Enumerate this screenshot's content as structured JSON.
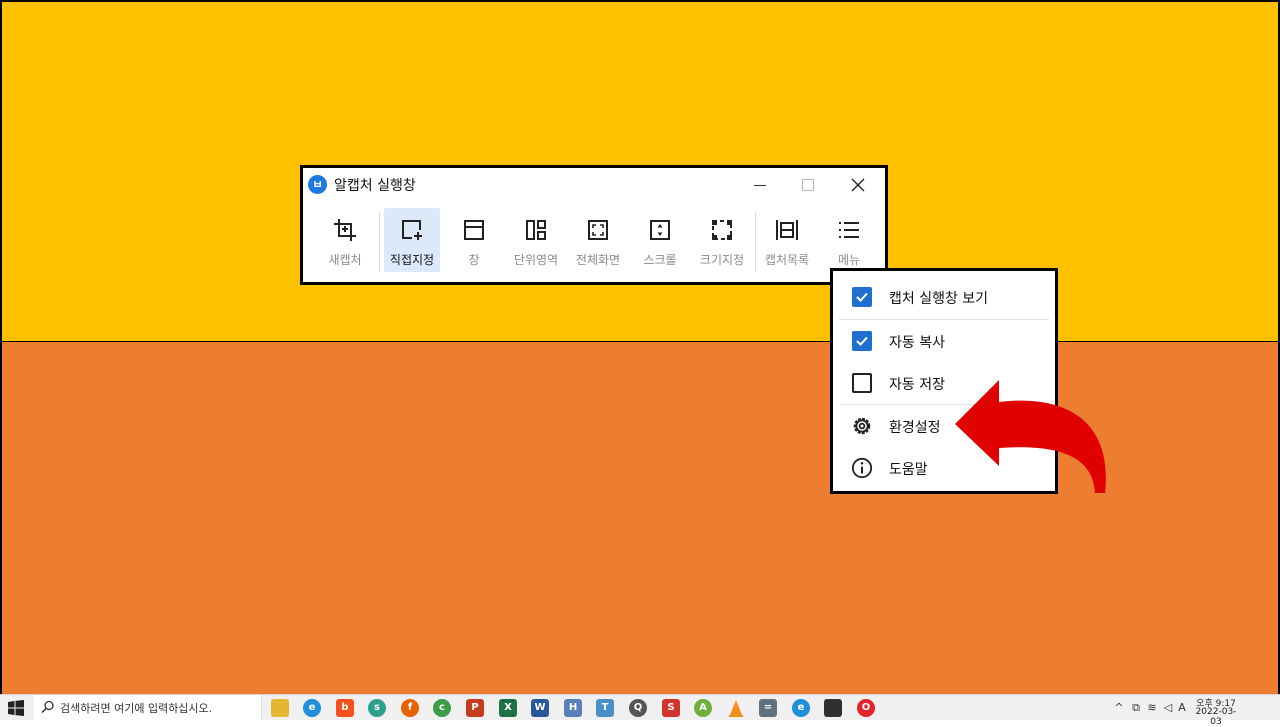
{
  "colors": {
    "background_top": "#FFC000",
    "background_bottom": "#ED7D31",
    "accent": "#1F6FD0",
    "active_tool_bg": "#DBE9F8",
    "arrow": "#E00000"
  },
  "window": {
    "title": "알캡처 실행창",
    "logo_icon": "alcapture-logo-icon",
    "controls": [
      "minimize",
      "maximize",
      "close"
    ]
  },
  "toolbar": {
    "active": "직접지정",
    "tools": [
      {
        "label": "새캡처",
        "icon": "crop-icon"
      },
      {
        "label": "직접지정",
        "icon": "region-select-icon"
      },
      {
        "label": "창",
        "icon": "window-icon"
      },
      {
        "label": "단위영역",
        "icon": "unit-area-icon"
      },
      {
        "label": "전체화면",
        "icon": "fullscreen-icon"
      },
      {
        "label": "스크롤",
        "icon": "scroll-icon"
      },
      {
        "label": "크기지정",
        "icon": "fixed-size-icon"
      },
      {
        "label": "캡처목록",
        "icon": "capture-list-icon"
      },
      {
        "label": "메뉴",
        "icon": "menu-icon"
      }
    ]
  },
  "menu": {
    "items": [
      {
        "label": "캡처 실행창 보기",
        "type": "checkbox",
        "checked": true
      },
      {
        "label": "자동 복사",
        "type": "checkbox",
        "checked": true
      },
      {
        "label": "자동 저장",
        "type": "checkbox",
        "checked": false
      },
      {
        "label": "환경설정",
        "type": "action",
        "icon": "gear-icon"
      },
      {
        "label": "도움말",
        "type": "action",
        "icon": "info-icon"
      }
    ]
  },
  "annotation": {
    "icon": "curved-red-arrow-icon",
    "points_to": "환경설정"
  },
  "taskbar": {
    "search_placeholder": "검색하려면 여기에 입력하십시오.",
    "apps": [
      "file-explorer",
      "edge",
      "brave",
      "app",
      "firefox",
      "chrome",
      "powerpoint",
      "excel",
      "word",
      "app",
      "app",
      "search",
      "app",
      "app",
      "vlc",
      "calculator",
      "edge",
      "sticky-notes",
      "opera"
    ],
    "tray": {
      "ime_label": "A"
    },
    "clock": {
      "time": "오후 9:17",
      "date": "2022-03-03"
    }
  }
}
